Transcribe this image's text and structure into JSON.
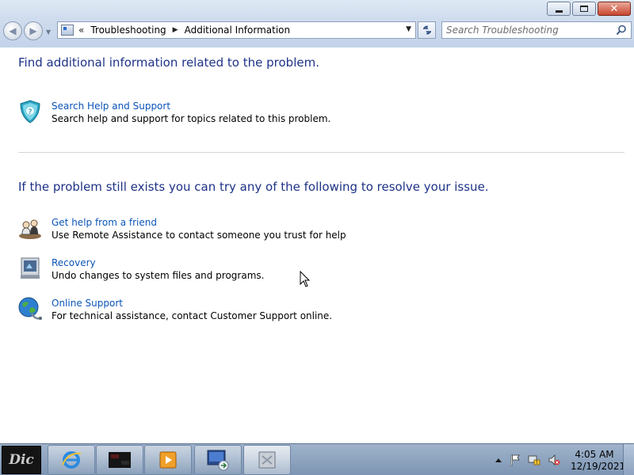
{
  "window": {
    "title": "",
    "controls": [
      "minimize",
      "maximize",
      "close"
    ]
  },
  "navigation": {
    "breadcrumb": [
      "Troubleshooting",
      "Additional Information"
    ],
    "overflow_glyph": "«",
    "search_placeholder": "Search Troubleshooting"
  },
  "main": {
    "section1_heading": "Find additional information related to the problem.",
    "search_help": {
      "title": "Search Help and Support",
      "description": "Search help and support for topics related to this problem.",
      "icon": "help-support-shield-icon"
    },
    "section2_heading": "If the problem still exists you can try any of the following to resolve your issue.",
    "options": [
      {
        "title": "Get help from a friend",
        "description": "Use Remote Assistance to contact someone you trust for help",
        "icon": "remote-assistance-icon"
      },
      {
        "title": "Recovery",
        "description": "Undo changes to system files and programs.",
        "icon": "recovery-icon"
      },
      {
        "title": "Online Support",
        "description": "For technical assistance, contact Customer Support online.",
        "icon": "globe-support-icon"
      }
    ]
  },
  "taskbar": {
    "start_label": "Dic",
    "pinned": [
      "internet-explorer-icon",
      "media-app-icon",
      "media-player-icon",
      "network-window-icon",
      "troubleshooting-window-icon"
    ],
    "tray_icons": [
      "show-hidden-icon",
      "action-center-flag-icon",
      "network-icon",
      "volume-muted-icon"
    ],
    "clock_time": "4:05 AM",
    "clock_date": "12/19/2021"
  },
  "colors": {
    "heading": "#1e3287",
    "link": "#0b55b8",
    "taskbar": "#8ea4c2",
    "chrome": "#cfdcee"
  }
}
